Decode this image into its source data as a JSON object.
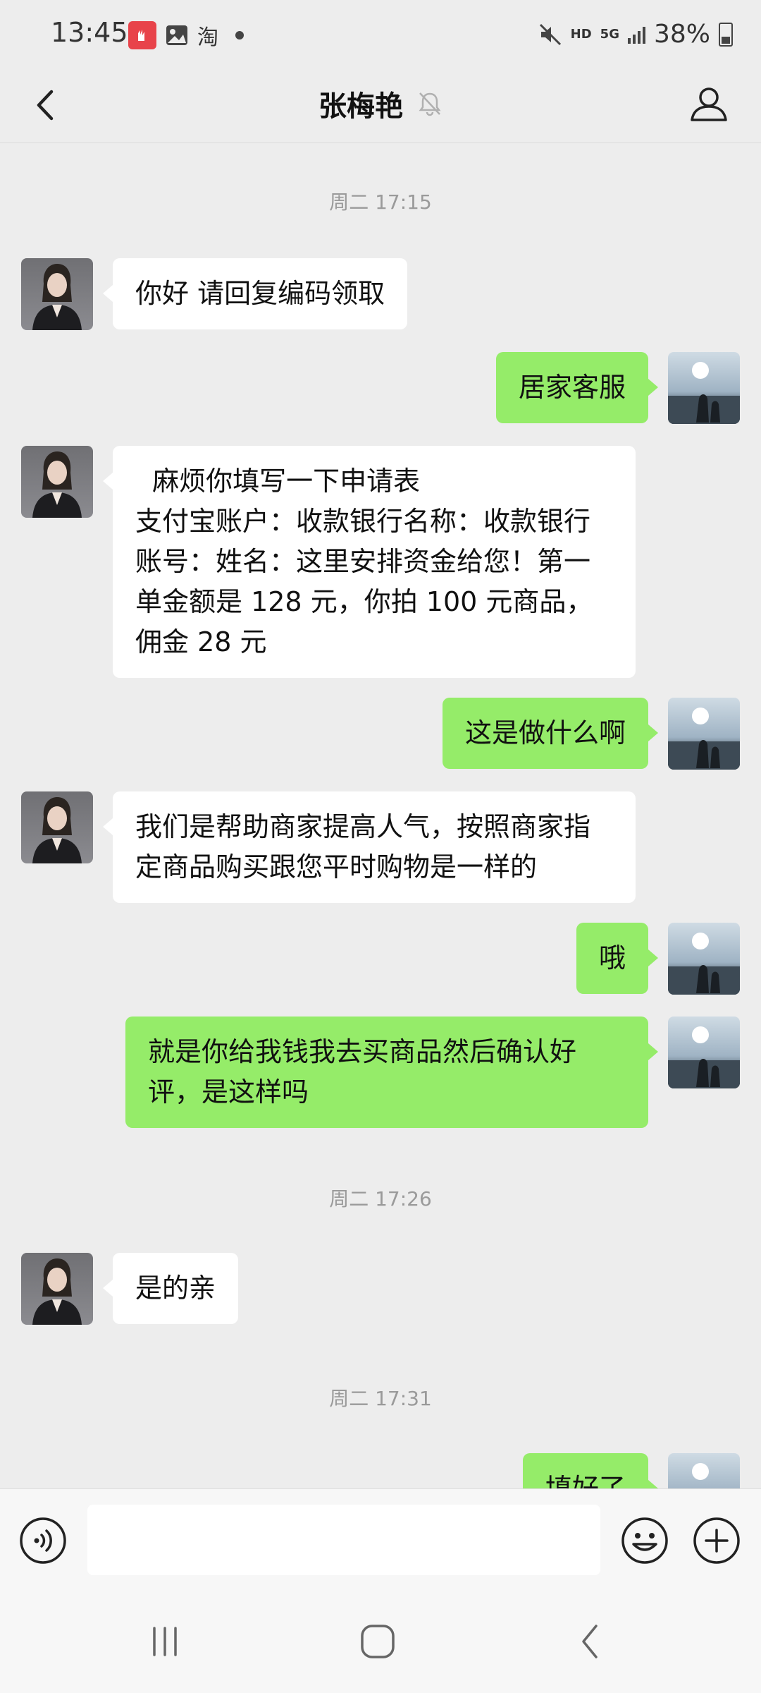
{
  "status_bar": {
    "time": "13:45",
    "network": "HD",
    "network_gen": "5G",
    "battery": "38%",
    "icons": [
      "app-notification-icon",
      "gallery-icon",
      "taobao-icon",
      "mute-icon",
      "signal-icon",
      "battery-icon"
    ],
    "taobao_glyph": "淘"
  },
  "header": {
    "title": "张梅艳",
    "icons": [
      "back-arrow-icon",
      "mute-bell-icon",
      "profile-icon"
    ]
  },
  "chat": {
    "timestamps": [
      "周二 17:15",
      "周二 17:26",
      "周二 17:31"
    ],
    "messages": [
      {
        "sender": "contact",
        "text": "你好 请回复编码领取"
      },
      {
        "sender": "me",
        "text": "居家客服"
      },
      {
        "sender": "contact",
        "text": "  麻烦你填写一下申请表\n支付宝账户：收款银行名称：收款银行账号：姓名：这里安排资金给您！第一单金额是 128 元，你拍 100 元商品，佣金 28 元"
      },
      {
        "sender": "me",
        "text": "这是做什么啊"
      },
      {
        "sender": "contact",
        "text": "我们是帮助商家提高人气，按照商家指定商品购买跟您平时购物是一样的"
      },
      {
        "sender": "me",
        "text": "哦"
      },
      {
        "sender": "me",
        "text": "就是你给我钱我去买商品然后确认好评，是这样吗"
      },
      {
        "sender": "contact",
        "text": "是的亲"
      },
      {
        "sender": "me",
        "text": "填好了"
      }
    ]
  },
  "input_bar": {
    "placeholder": "",
    "icons": [
      "voice-icon",
      "emoji-icon",
      "plus-icon"
    ]
  },
  "nav_bar": {
    "icons": [
      "recent-apps-icon",
      "home-icon",
      "back-icon"
    ]
  },
  "colors": {
    "background": "#ededed",
    "incoming_bubble": "#ffffff",
    "outgoing_bubble": "#95ec69",
    "timestamp_text": "#9a9a9a"
  }
}
